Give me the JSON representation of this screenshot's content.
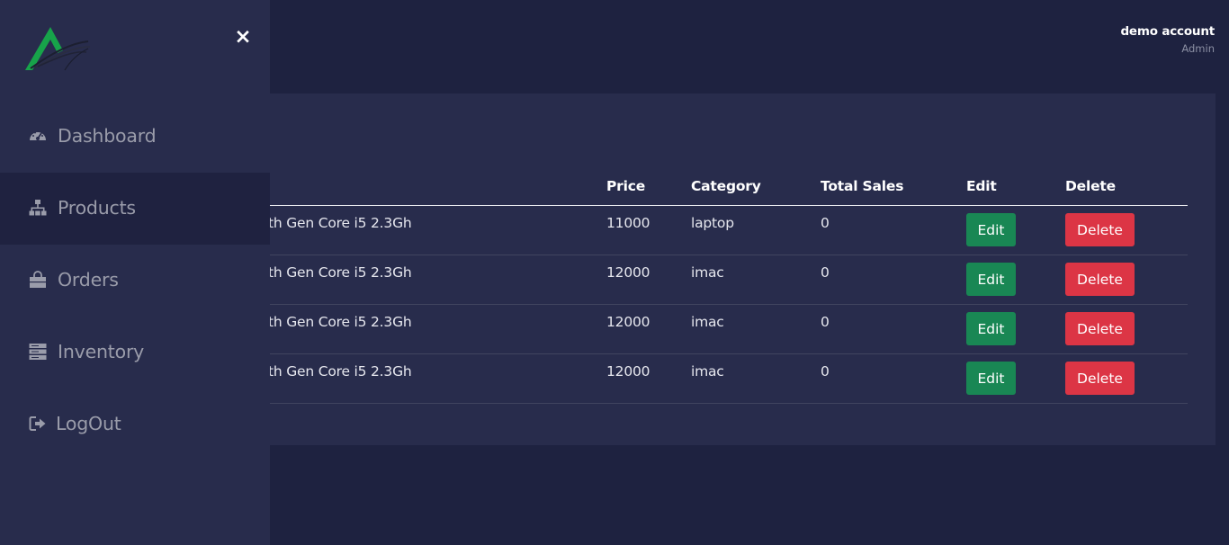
{
  "user": {
    "name": "demo account",
    "role": "Admin"
  },
  "sidebar": {
    "close_icon": "×",
    "items": [
      {
        "label": "Dashboard",
        "icon": "gauge-icon"
      },
      {
        "label": "Products",
        "icon": "sitemap-icon",
        "active": true
      },
      {
        "label": "Orders",
        "icon": "shopping-bag-icon"
      },
      {
        "label": "Inventory",
        "icon": "server-icon"
      },
      {
        "label": "LogOut",
        "icon": "sign-out-icon"
      }
    ]
  },
  "table": {
    "headers": [
      "Price",
      "Category",
      "Total Sales",
      "Edit",
      "Delete"
    ],
    "rows": [
      {
        "name": "th Gen Core i5 2.3Gh",
        "price": "11000",
        "category": "laptop",
        "sales": "0",
        "edit": "Edit",
        "delete": "Delete"
      },
      {
        "name": "th Gen Core i5 2.3Gh",
        "price": "12000",
        "category": "imac",
        "sales": "0",
        "edit": "Edit",
        "delete": "Delete"
      },
      {
        "name": "th Gen Core i5 2.3Gh",
        "price": "12000",
        "category": "imac",
        "sales": "0",
        "edit": "Edit",
        "delete": "Delete"
      },
      {
        "name": "th Gen Core i5 2.3Gh",
        "price": "12000",
        "category": "imac",
        "sales": "0",
        "edit": "Edit",
        "delete": "Delete"
      }
    ]
  },
  "colors": {
    "background": "#1e2240",
    "panel": "#282c4c",
    "edit": "#198754",
    "delete": "#dc3545",
    "logo": "#17a34a"
  }
}
